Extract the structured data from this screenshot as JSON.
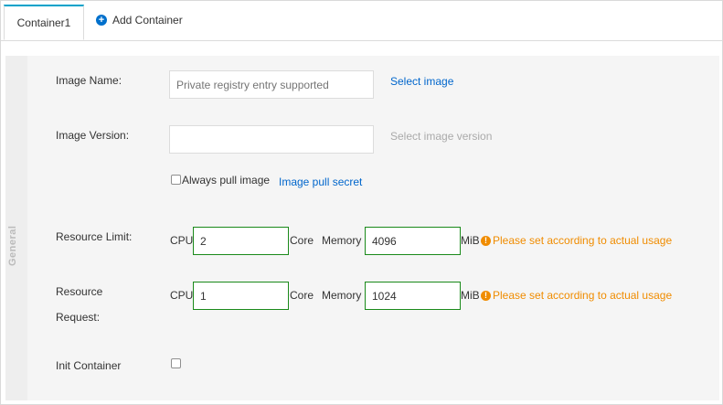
{
  "tabs": {
    "active_label": "Container1",
    "add_label": "Add Container"
  },
  "sidebar": {
    "label": "General"
  },
  "form": {
    "image_name": {
      "label": "Image Name:",
      "placeholder": "Private registry entry supported",
      "value": "",
      "action": "Select image"
    },
    "image_version": {
      "label": "Image Version:",
      "value": "",
      "action": "Select image version"
    },
    "always_pull": {
      "label": "Always pull image",
      "checked": false,
      "secret_link": "Image pull secret"
    },
    "resource_limit": {
      "label": "Resource Limit:",
      "cpu_label": "CPU",
      "cpu_value": "2",
      "cpu_unit": "Core",
      "memory_label": "Memory",
      "memory_value": "4096",
      "memory_unit": "MiB",
      "hint": "Please set according to actual usage"
    },
    "resource_request": {
      "label_line1": "Resource",
      "label_line2": "Request:",
      "cpu_label": "CPU",
      "cpu_value": "1",
      "cpu_unit": "Core",
      "memory_label": "Memory",
      "memory_value": "1024",
      "memory_unit": "MiB",
      "hint": "Please set according to actual usage"
    },
    "init_container": {
      "label": "Init Container",
      "checked": false
    }
  },
  "colors": {
    "accent": "#00a2ca",
    "link": "#0066cc",
    "warning": "#f08c00",
    "valid_border": "#1a8a1a"
  }
}
